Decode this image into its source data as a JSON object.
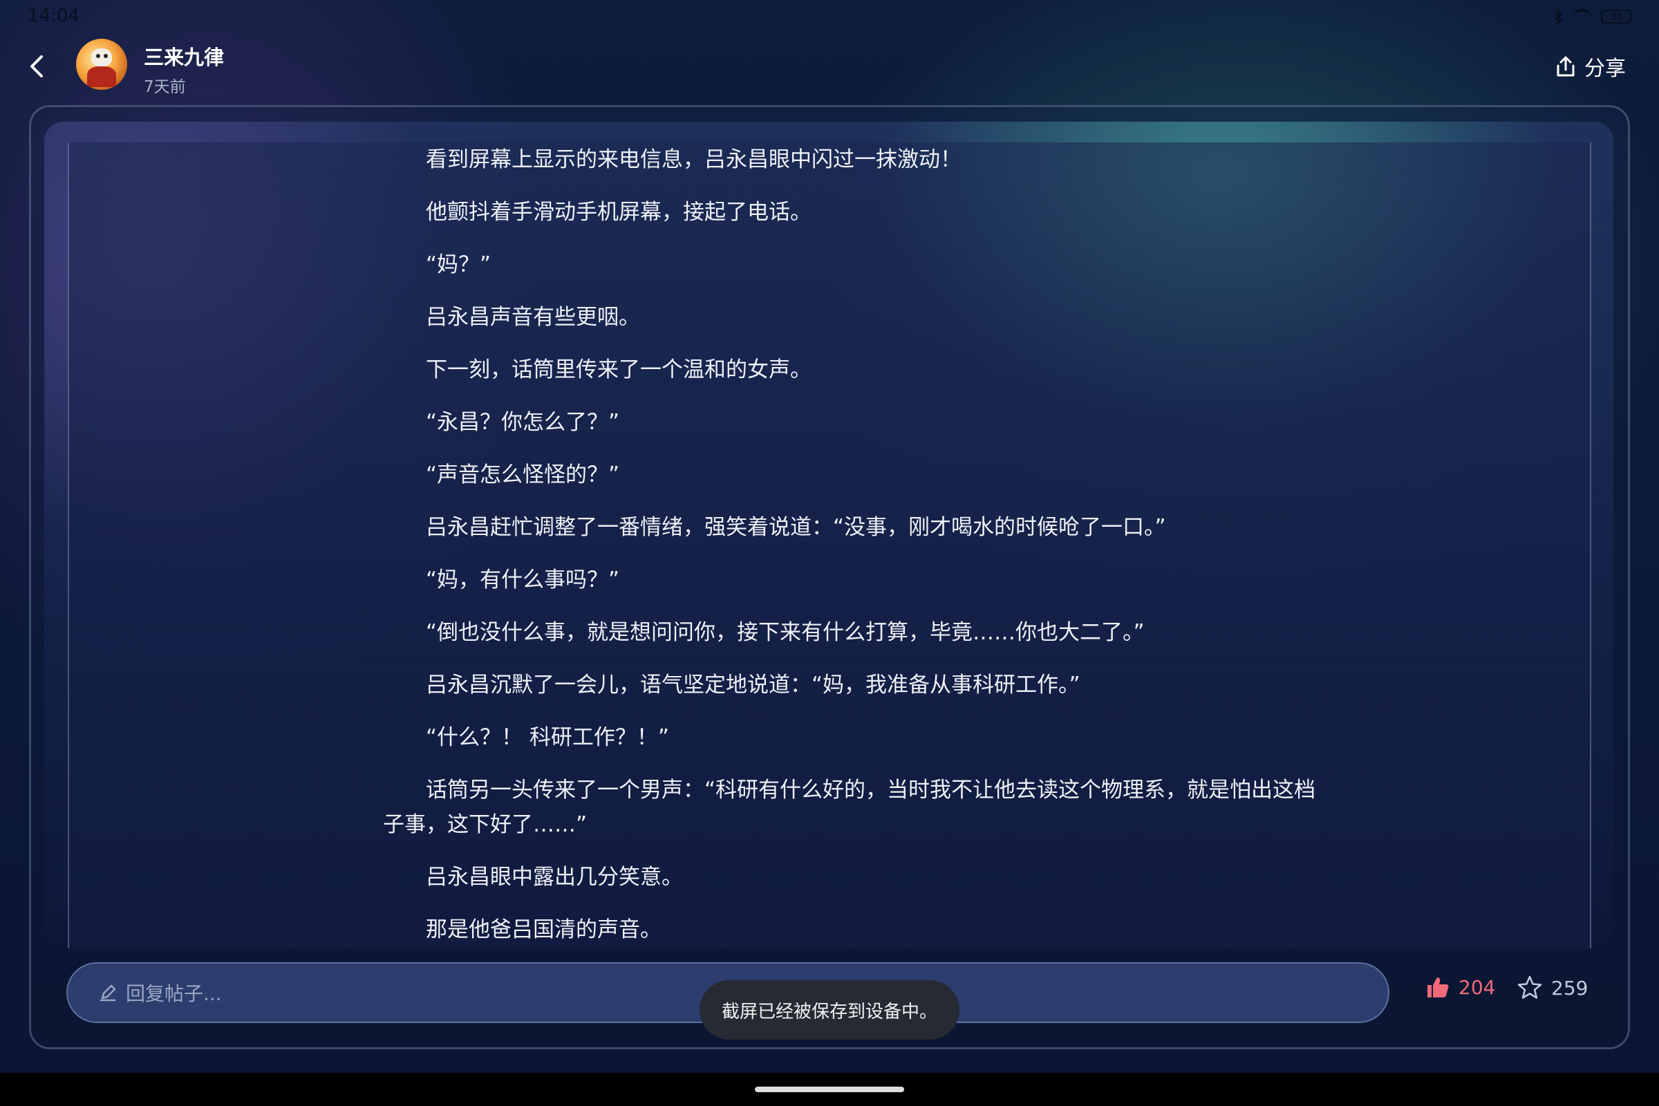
{
  "status_bar": {
    "time": "14:04",
    "battery": "38"
  },
  "header": {
    "back_icon": "chevron-left-icon",
    "author_name": "三来九律",
    "post_time": "7天前",
    "share_label": "分享",
    "share_icon": "share-icon"
  },
  "content": {
    "paragraphs": [
      "看到屏幕上显示的来电信息，吕永昌眼中闪过一抹激动！",
      "他颤抖着手滑动手机屏幕，接起了电话。",
      "“妈？”",
      "吕永昌声音有些更咽。",
      "下一刻，话筒里传来了一个温和的女声。",
      "“永昌？你怎么了？”",
      "“声音怎么怪怪的？”",
      "吕永昌赶忙调整了一番情绪，强笑着说道：“没事，刚才喝水的时候呛了一口。”",
      "“妈，有什么事吗？”",
      "“倒也没什么事，就是想问问你，接下来有什么打算，毕竟……你也大二了。”",
      "吕永昌沉默了一会儿，语气坚定地说道：“妈，我准备从事科研工作。”",
      "“什么？！ 科研工作？！”",
      "话筒另一头传来了一个男声：“科研有什么好的，当时我不让他去读这个物理系，就是怕出这档子事，这下好了……”",
      "吕永昌眼中露出几分笑意。",
      "那是他爸吕国清的声音。"
    ]
  },
  "bottom_bar": {
    "reply_placeholder": "回复帖子...",
    "like_count": "204",
    "favorite_count": "259",
    "colors": {
      "like": "#f06a7a"
    }
  },
  "toast": {
    "message": "截屏已经被保存到设备中。"
  }
}
